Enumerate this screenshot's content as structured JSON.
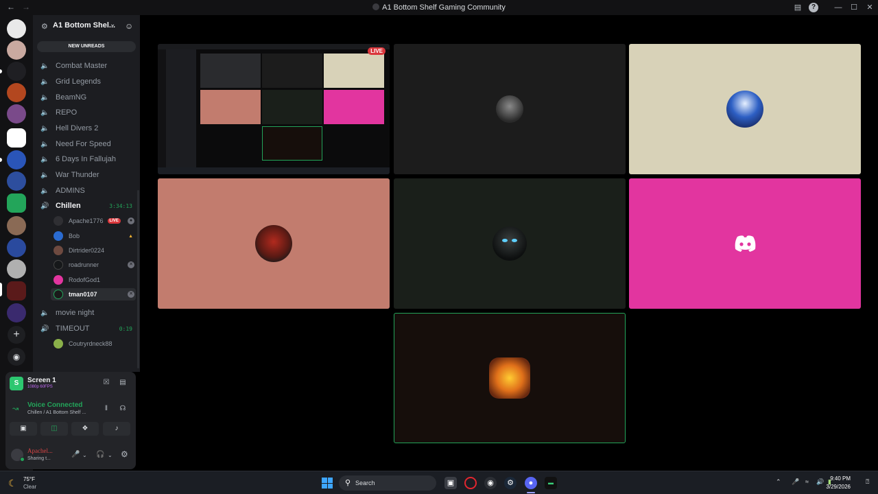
{
  "window": {
    "title": "A1 Bottom Shelf Gaming Community"
  },
  "guild": {
    "name": "A1 Bottom Shel...",
    "new_unreads": "NEW UNREADS"
  },
  "channels": [
    {
      "name": "Combat Master"
    },
    {
      "name": "Grid Legends"
    },
    {
      "name": "BeamNG"
    },
    {
      "name": "REPO"
    },
    {
      "name": "Hell Divers 2"
    },
    {
      "name": "Need For Speed"
    },
    {
      "name": "6 Days In Fallujah"
    },
    {
      "name": "War Thunder"
    },
    {
      "name": "ADMINS"
    },
    {
      "name": "Chillen",
      "timer": "3:34:13"
    }
  ],
  "chillen_members": [
    {
      "name": "Apache1776",
      "live": "LIVE"
    },
    {
      "name": "Bob"
    },
    {
      "name": "Dirtrider0224"
    },
    {
      "name": "roadrunner"
    },
    {
      "name": "RodofGod1"
    },
    {
      "name": "tman0107"
    }
  ],
  "more_channels": [
    {
      "name": "movie night"
    },
    {
      "name": "TIMEOUT",
      "timer": "0:19"
    }
  ],
  "timeout_members": [
    {
      "name": "Coutryrdneck88"
    }
  ],
  "panel": {
    "screen_title": "Screen 1",
    "screen_quality": "1080p 60FPS",
    "voice_status": "Voice Connected",
    "voice_channel": "Chillen / A1 Bottom Shelf ...",
    "user_name": "Apachel...",
    "user_status": "Sharing t..."
  },
  "stage": {
    "live_label": "LIVE"
  },
  "taskbar": {
    "temperature": "75°F",
    "condition": "Clear",
    "search_label": "Search",
    "time": "9:40 PM",
    "date": "3/29/2026"
  },
  "colors": {
    "accent_green": "#23a55a",
    "live_red": "#da373c",
    "tile_beige": "#d8d2b8",
    "tile_salmon": "#c27c6e",
    "tile_pink": "#e2359f",
    "tile_darkgreen": "#1a1f1a"
  }
}
